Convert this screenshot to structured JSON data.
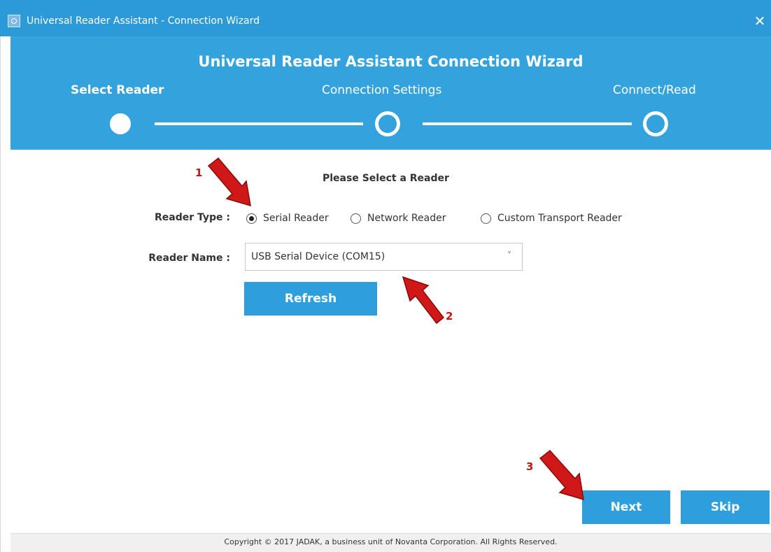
{
  "window": {
    "title": "Universal Reader Assistant - Connection Wizard",
    "close_glyph": "✕",
    "app_icon": "app-icon"
  },
  "wizard": {
    "title": "Universal Reader Assistant Connection Wizard",
    "steps": [
      {
        "label": "Select Reader",
        "state": "current"
      },
      {
        "label": "Connection Settings",
        "state": "pending"
      },
      {
        "label": "Connect/Read",
        "state": "pending"
      }
    ]
  },
  "form": {
    "prompt": "Please Select a Reader",
    "reader_type_label": "Reader Type :",
    "reader_types": [
      {
        "label": "Serial Reader",
        "checked": true
      },
      {
        "label": "Network Reader",
        "checked": false
      },
      {
        "label": "Custom Transport Reader",
        "checked": false
      }
    ],
    "reader_name_label": "Reader Name :",
    "reader_name_value": "USB Serial Device (COM15)",
    "dropdown_caret": "˅",
    "refresh_label": "Refresh"
  },
  "actions": {
    "next_label": "Next",
    "skip_label": "Skip"
  },
  "annotations": {
    "labels": [
      "1",
      "2",
      "3"
    ],
    "color": "#cc1111"
  },
  "footer": {
    "copyright": "Copyright © 2017 JADAK, a business unit of Novanta Corporation. All Rights Reserved."
  },
  "colors": {
    "titlebar": "#2b9ad6",
    "banner": "#34a3dd",
    "button": "#2e9fdc"
  }
}
